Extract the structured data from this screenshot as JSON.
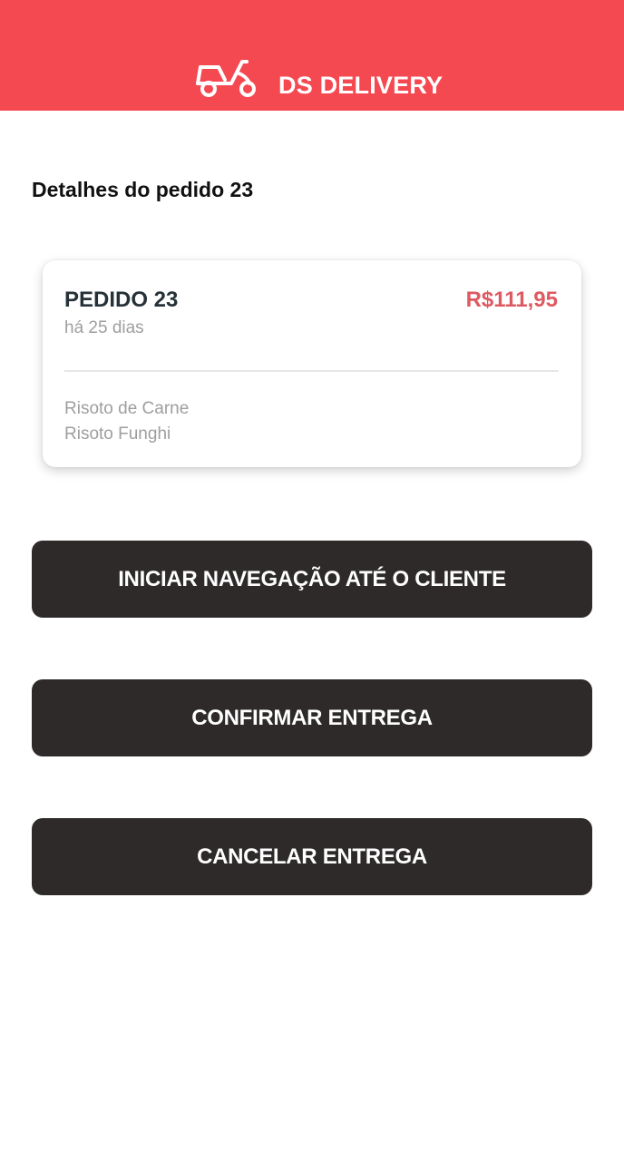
{
  "header": {
    "title": "DS DELIVERY",
    "logo_icon": "scooter-icon",
    "background_color": "#F54952"
  },
  "page": {
    "title": "Detalhes do pedido 23"
  },
  "order": {
    "name": "PEDIDO 23",
    "price": "R$111,95",
    "time": "há 25 dias",
    "products": [
      "Risoto de Carne",
      "Risoto Funghi"
    ],
    "price_color": "#DE5A62"
  },
  "buttons": {
    "navigate_label": "INICIAR NAVEGAÇÃO ATÉ O CLIENTE",
    "confirm_label": "CONFIRMAR ENTREGA",
    "cancel_label": "CANCELAR ENTREGA",
    "color": "#2D2A29"
  }
}
